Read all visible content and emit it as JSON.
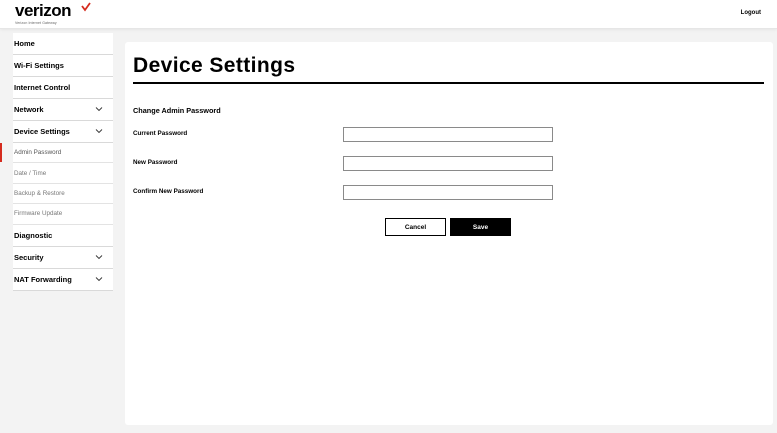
{
  "header": {
    "brand": "verizon",
    "brand_sub": "Verizon Internet Gateway",
    "logout_label": "Logout",
    "accent_color": "#d52b1e"
  },
  "sidebar": {
    "items": [
      {
        "label": "Home"
      },
      {
        "label": "Wi-Fi Settings"
      },
      {
        "label": "Internet Control"
      },
      {
        "label": "Network",
        "expandable": true
      },
      {
        "label": "Device Settings",
        "expandable": true,
        "expanded": true
      },
      {
        "label": "Admin Password",
        "sub": true,
        "active": true
      },
      {
        "label": "Date / Time",
        "sub": true
      },
      {
        "label": "Backup & Restore",
        "sub": true
      },
      {
        "label": "Firmware Update",
        "sub": true
      },
      {
        "label": "Diagnostic"
      },
      {
        "label": "Security",
        "expandable": true
      },
      {
        "label": "NAT Forwarding",
        "expandable": true
      }
    ]
  },
  "main": {
    "title": "Device Settings",
    "section_title": "Change Admin Password",
    "fields": [
      {
        "label": "Current Password",
        "value": ""
      },
      {
        "label": "New Password",
        "value": ""
      },
      {
        "label": "Confirm New Password",
        "value": ""
      }
    ],
    "cancel_label": "Cancel",
    "save_label": "Save"
  }
}
